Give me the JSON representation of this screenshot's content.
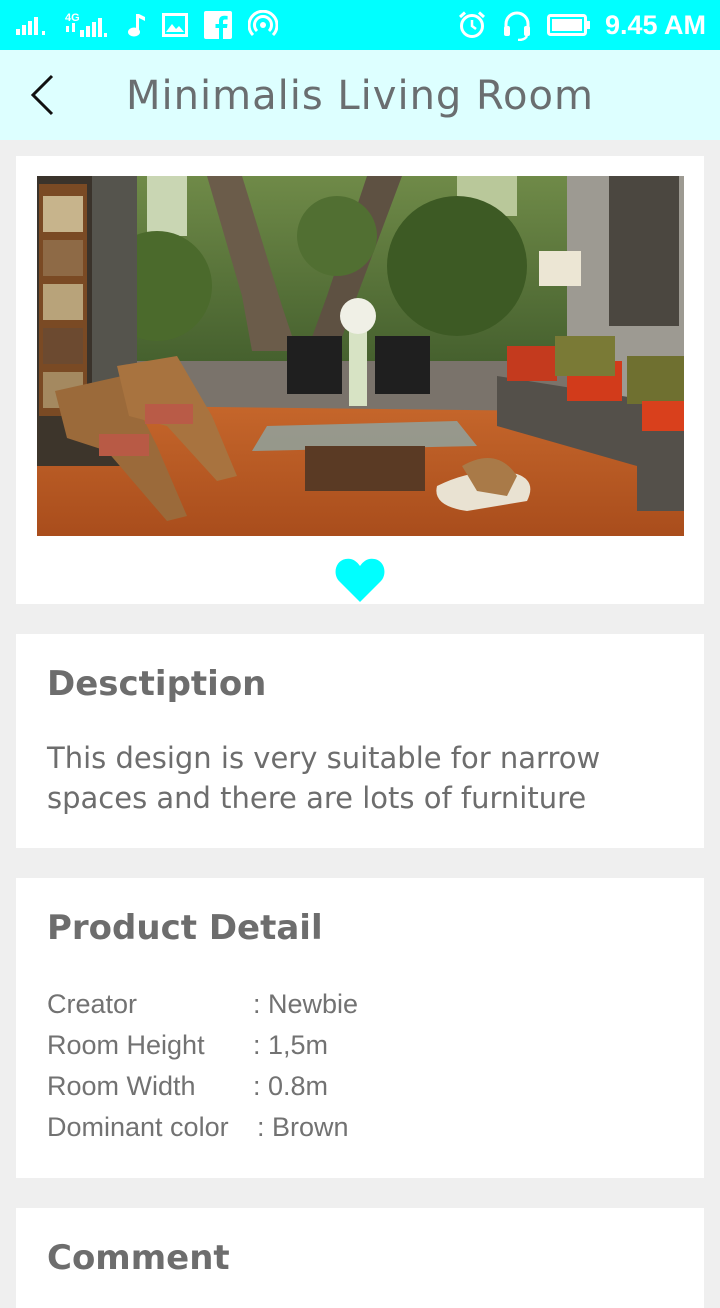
{
  "status_bar": {
    "network": "4G",
    "time": "9.45 AM",
    "icons": [
      "signal-icon",
      "signal-4g-icon",
      "music-note-icon",
      "image-icon",
      "facebook-icon",
      "hotspot-icon",
      "alarm-icon",
      "headset-icon",
      "battery-icon"
    ],
    "color": "#00ffff"
  },
  "app_bar": {
    "title": "Minimalis Living Room",
    "back_icon": "chevron-left-icon",
    "background": "#ddffff"
  },
  "product": {
    "image_alt": "Living room with orange rug, grey sofa, wooden lounge chairs and garden view",
    "favorite_icon": "heart-icon",
    "favorite_color": "#00ffff"
  },
  "description": {
    "heading": "Desctiption",
    "text": "This design is very suitable for narrow spaces and there are lots of furniture"
  },
  "detail": {
    "heading": "Product Detail",
    "rows": [
      {
        "label": "Creator",
        "value": ": Newbie"
      },
      {
        "label": "Room Height",
        "value": ": 1,5m"
      },
      {
        "label": "Room Width",
        "value": ": 0.8m"
      },
      {
        "label": "Dominant color",
        "value": ": Brown"
      }
    ]
  },
  "comment": {
    "heading": "Comment"
  }
}
